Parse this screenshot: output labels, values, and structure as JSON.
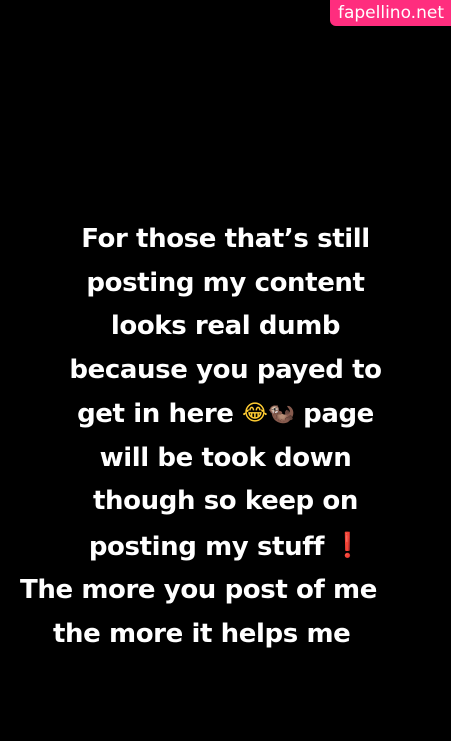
{
  "watermark": {
    "text": "fapellino.net",
    "background_color": "#ff2d7e"
  },
  "story": {
    "background_color": "#000000",
    "text_color": "#ffffff",
    "lines": [
      "For those that’s still",
      "posting my content",
      "looks real dumb",
      "because you payed to",
      "get in here",
      "page",
      "will be took down",
      "though so keep on",
      "posting my stuff",
      "The more you post of me",
      "the more it helps me"
    ],
    "emojis": {
      "laughing": "😂",
      "otter": "🦦",
      "exclamation": "❗"
    },
    "emoji_names": [
      "face-with-tears-of-joy-emoji",
      "otter-emoji",
      "red-exclamation-emoji"
    ]
  }
}
